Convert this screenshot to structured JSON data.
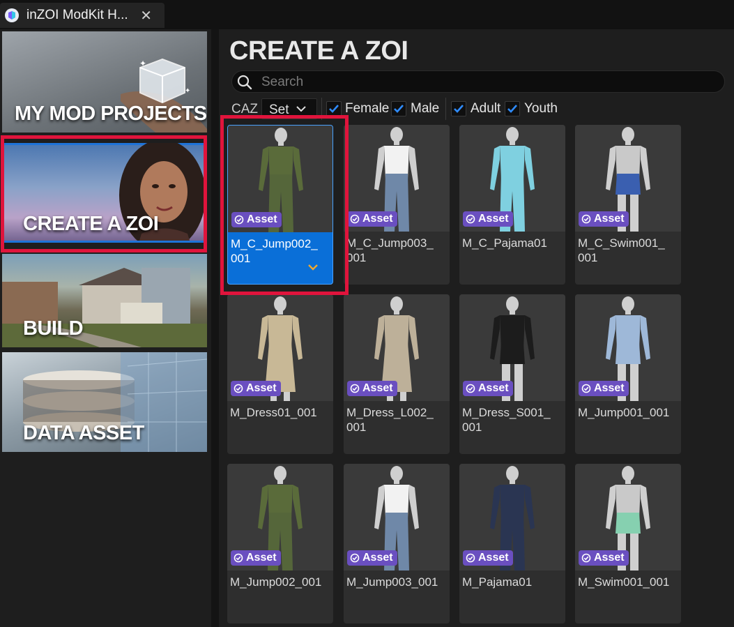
{
  "window": {
    "tab_title": "inZOI ModKit H...",
    "close_glyph": "✕",
    "app_icon": "inzoi-app-icon"
  },
  "sidebar": {
    "items": [
      {
        "label": "MY MOD PROJECTS"
      },
      {
        "label": "CREATE A ZOI",
        "selected": true
      },
      {
        "label": "BUILD"
      },
      {
        "label": "DATA ASSET"
      }
    ]
  },
  "main": {
    "title": "CREATE A ZOI",
    "search": {
      "placeholder": "Search",
      "value": ""
    },
    "filters": {
      "category_label": "CAZ",
      "type_dropdown": {
        "value": "Set"
      },
      "checkboxes": [
        {
          "label": "Female",
          "checked": true
        },
        {
          "label": "Male",
          "checked": true
        },
        {
          "label": "Adult",
          "checked": true
        },
        {
          "label": "Youth",
          "checked": true
        }
      ]
    },
    "badge_label": "Asset",
    "assets": [
      {
        "name": "M_C_Jump002_001",
        "display": "M_C_Jump002_\n001",
        "selected": true,
        "outfit": "green-jumpsuit"
      },
      {
        "name": "M_C_Jump003_001",
        "display": "M_C_Jump003_\n001",
        "outfit": "denim-overalls"
      },
      {
        "name": "M_C_Pajama01",
        "display": "M_C_Pajama01",
        "outfit": "cyan-pajamas"
      },
      {
        "name": "M_C_Swim001_001",
        "display": "M_C_Swim001_\n001",
        "outfit": "blue-swim-shorts"
      },
      {
        "name": "M_Dress01_001",
        "display": "M_Dress01_001",
        "outfit": "beige-wrap-dress"
      },
      {
        "name": "M_Dress_L002_001",
        "display": "M_Dress_L002_\n001",
        "outfit": "beige-strapless-dress"
      },
      {
        "name": "M_Dress_S001_001",
        "display": "M_Dress_S001_\n001",
        "outfit": "black-short-dress"
      },
      {
        "name": "M_Jump001_001",
        "display": "M_Jump001_001",
        "outfit": "light-blue-romper"
      },
      {
        "name": "M_Jump002_001",
        "display": "M_Jump002_001",
        "outfit": "green-jumpsuit"
      },
      {
        "name": "M_Jump003_001",
        "display": "M_Jump003_001",
        "outfit": "denim-overalls"
      },
      {
        "name": "M_Pajama01",
        "display": "M_Pajama01",
        "outfit": "navy-pajamas"
      },
      {
        "name": "M_Swim001_001",
        "display": "M_Swim001_001",
        "outfit": "mint-swim-shorts"
      }
    ]
  },
  "colors": {
    "accent_blue": "#0a6fd8",
    "highlight_red": "#e0143c",
    "badge_purple": "#6a4fc0",
    "check_blue": "#2f8cff"
  }
}
